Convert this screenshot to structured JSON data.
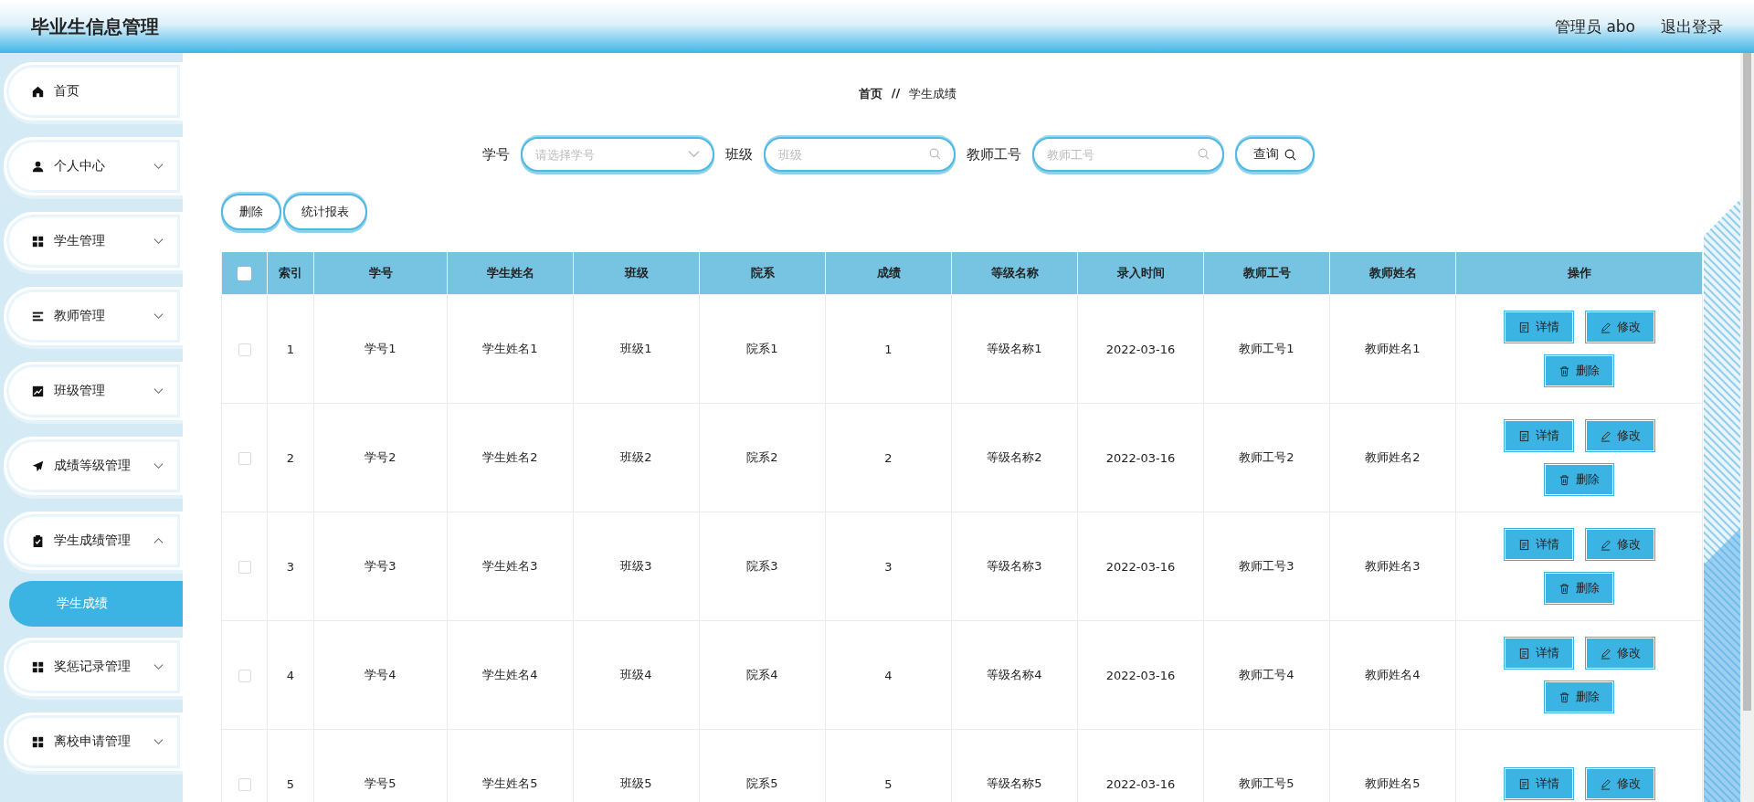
{
  "header": {
    "title": "毕业生信息管理",
    "user": "管理员 abo",
    "logout": "退出登录"
  },
  "sidebar": {
    "items": [
      {
        "label": "首页",
        "expandable": false
      },
      {
        "label": "个人中心",
        "expandable": true,
        "expanded": false
      },
      {
        "label": "学生管理",
        "expandable": true,
        "expanded": false
      },
      {
        "label": "教师管理",
        "expandable": true,
        "expanded": false
      },
      {
        "label": "班级管理",
        "expandable": true,
        "expanded": false
      },
      {
        "label": "成绩等级管理",
        "expandable": true,
        "expanded": false
      },
      {
        "label": "学生成绩管理",
        "expandable": true,
        "expanded": true,
        "children": [
          {
            "label": "学生成绩",
            "selected": true
          }
        ]
      },
      {
        "label": "奖惩记录管理",
        "expandable": true,
        "expanded": false
      },
      {
        "label": "离校申请管理",
        "expandable": true,
        "expanded": false
      }
    ]
  },
  "breadcrumb": {
    "home": "首页",
    "separator": "//",
    "current": "学生成绩"
  },
  "search": {
    "fields": [
      {
        "label": "学号",
        "kind": "select",
        "placeholder": "请选择学号"
      },
      {
        "label": "班级",
        "kind": "text",
        "placeholder": "班级"
      },
      {
        "label": "教师工号",
        "kind": "text",
        "placeholder": "教师工号"
      }
    ],
    "button": "查询"
  },
  "toolbar": [
    "删除",
    "统计报表"
  ],
  "table": {
    "all_selected": false,
    "columns": [
      "索引",
      "学号",
      "学生姓名",
      "班级",
      "院系",
      "成绩",
      "等级名称",
      "录入时间",
      "教师工号",
      "教师姓名",
      "操作"
    ],
    "rows": [
      {
        "selected": false,
        "cells": [
          "1",
          "学号1",
          "学生姓名1",
          "班级1",
          "院系1",
          "1",
          "等级名称1",
          "2022-03-16",
          "教师工号1",
          "教师姓名1"
        ],
        "actions": [
          "详情",
          "修改",
          "删除"
        ]
      },
      {
        "selected": false,
        "cells": [
          "2",
          "学号2",
          "学生姓名2",
          "班级2",
          "院系2",
          "2",
          "等级名称2",
          "2022-03-16",
          "教师工号2",
          "教师姓名2"
        ],
        "actions": [
          "详情",
          "修改",
          "删除"
        ]
      },
      {
        "selected": false,
        "cells": [
          "3",
          "学号3",
          "学生姓名3",
          "班级3",
          "院系3",
          "3",
          "等级名称3",
          "2022-03-16",
          "教师工号3",
          "教师姓名3"
        ],
        "actions": [
          "详情",
          "修改",
          "删除"
        ]
      },
      {
        "selected": false,
        "cells": [
          "4",
          "学号4",
          "学生姓名4",
          "班级4",
          "院系4",
          "4",
          "等级名称4",
          "2022-03-16",
          "教师工号4",
          "教师姓名4"
        ],
        "actions": [
          "详情",
          "修改",
          "删除"
        ]
      },
      {
        "selected": false,
        "cells": [
          "5",
          "学号5",
          "学生姓名5",
          "班级5",
          "院系5",
          "5",
          "等级名称5",
          "2022-03-16",
          "教师工号5",
          "教师姓名5"
        ],
        "actions": [
          "详情",
          "修改"
        ]
      }
    ]
  }
}
